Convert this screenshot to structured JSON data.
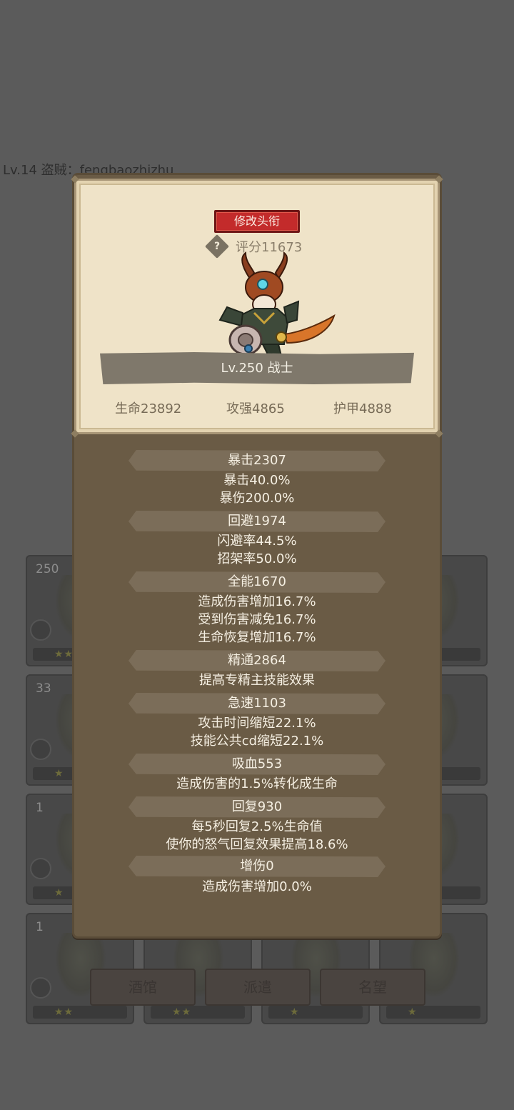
{
  "background": {
    "header_text": "Lv.14 盗贼：fengbaozhizhu",
    "card_levels": [
      "250",
      "33",
      "1",
      "1"
    ],
    "tabs": [
      "酒馆",
      "派遣",
      "名望"
    ]
  },
  "modal": {
    "edit_title_button": "修改头衔",
    "score": "评分11673",
    "level_class": "Lv.250 战士",
    "basic_stats": {
      "hp": "生命23892",
      "attack": "攻强4865",
      "armor": "护甲4888"
    },
    "sections": [
      {
        "title": "暴击2307",
        "lines": [
          "暴击40.0%",
          "暴伤200.0%"
        ]
      },
      {
        "title": "回避1974",
        "lines": [
          "闪避率44.5%",
          "招架率50.0%"
        ]
      },
      {
        "title": "全能1670",
        "lines": [
          "造成伤害增加16.7%",
          "受到伤害减免16.7%",
          "生命恢复增加16.7%"
        ]
      },
      {
        "title": "精通2864",
        "lines": [
          "提高专精主技能效果"
        ]
      },
      {
        "title": "急速1103",
        "lines": [
          "攻击时间缩短22.1%",
          "技能公共cd缩短22.1%"
        ]
      },
      {
        "title": "吸血553",
        "lines": [
          "造成伤害的1.5%转化成生命"
        ]
      },
      {
        "title": "回复930",
        "lines": [
          "每5秒回复2.5%生命值",
          "使你的怒气回复效果提高18.6%"
        ]
      },
      {
        "title": "增伤0",
        "lines": [
          "造成伤害增加0.0%"
        ]
      }
    ]
  },
  "icons": {
    "help": "question-diamond-icon",
    "hero": "warrior-hero-portrait"
  },
  "colors": {
    "edit_button": "#c32b2b",
    "parchment": "#efe3c8",
    "panel": "#6a5b45"
  }
}
